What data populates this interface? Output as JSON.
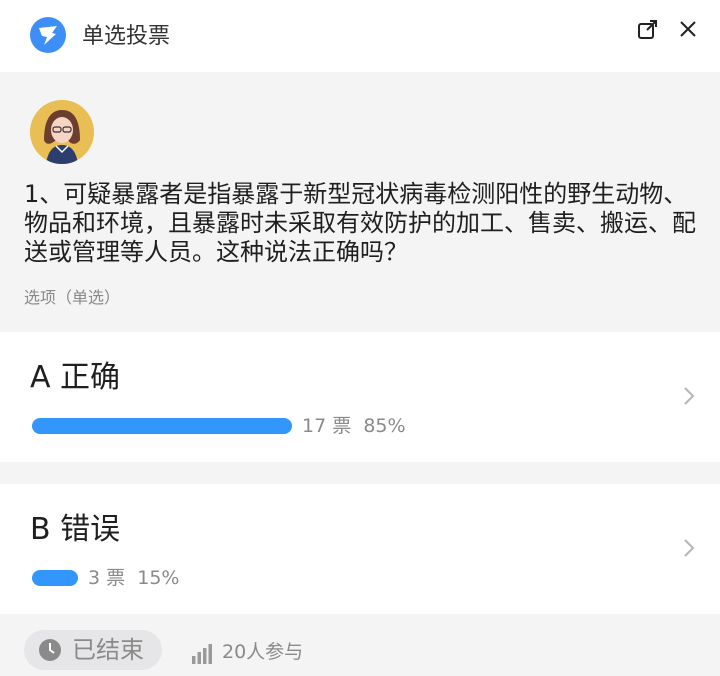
{
  "header": {
    "title": "单选投票",
    "logo_icon": "app-logo-icon",
    "open_external_icon": "open-external-icon",
    "close_icon": "close-icon",
    "brand_color": "#3e8ef7"
  },
  "question": {
    "text": "1、可疑暴露者是指暴露于新型冠状病毒检测阳性的野生动物、物品和环境，且暴露时未采取有效防护的加工、售卖、搬运、配送或管理等人员。这种说法正确吗？",
    "option_type": "选项（单选）"
  },
  "options": [
    {
      "label": "A 正确",
      "votes_text": "17 票",
      "percent_text": "85%",
      "fraction": 0.85
    },
    {
      "label": "B 错误",
      "votes_text": "3 票",
      "percent_text": "15%",
      "fraction": 0.15
    }
  ],
  "footer": {
    "status": "已结束",
    "participants": "20人参与"
  },
  "colors": {
    "bar": "#3296fa",
    "muted_text": "#8a8a8a",
    "background": "#f4f4f5"
  }
}
